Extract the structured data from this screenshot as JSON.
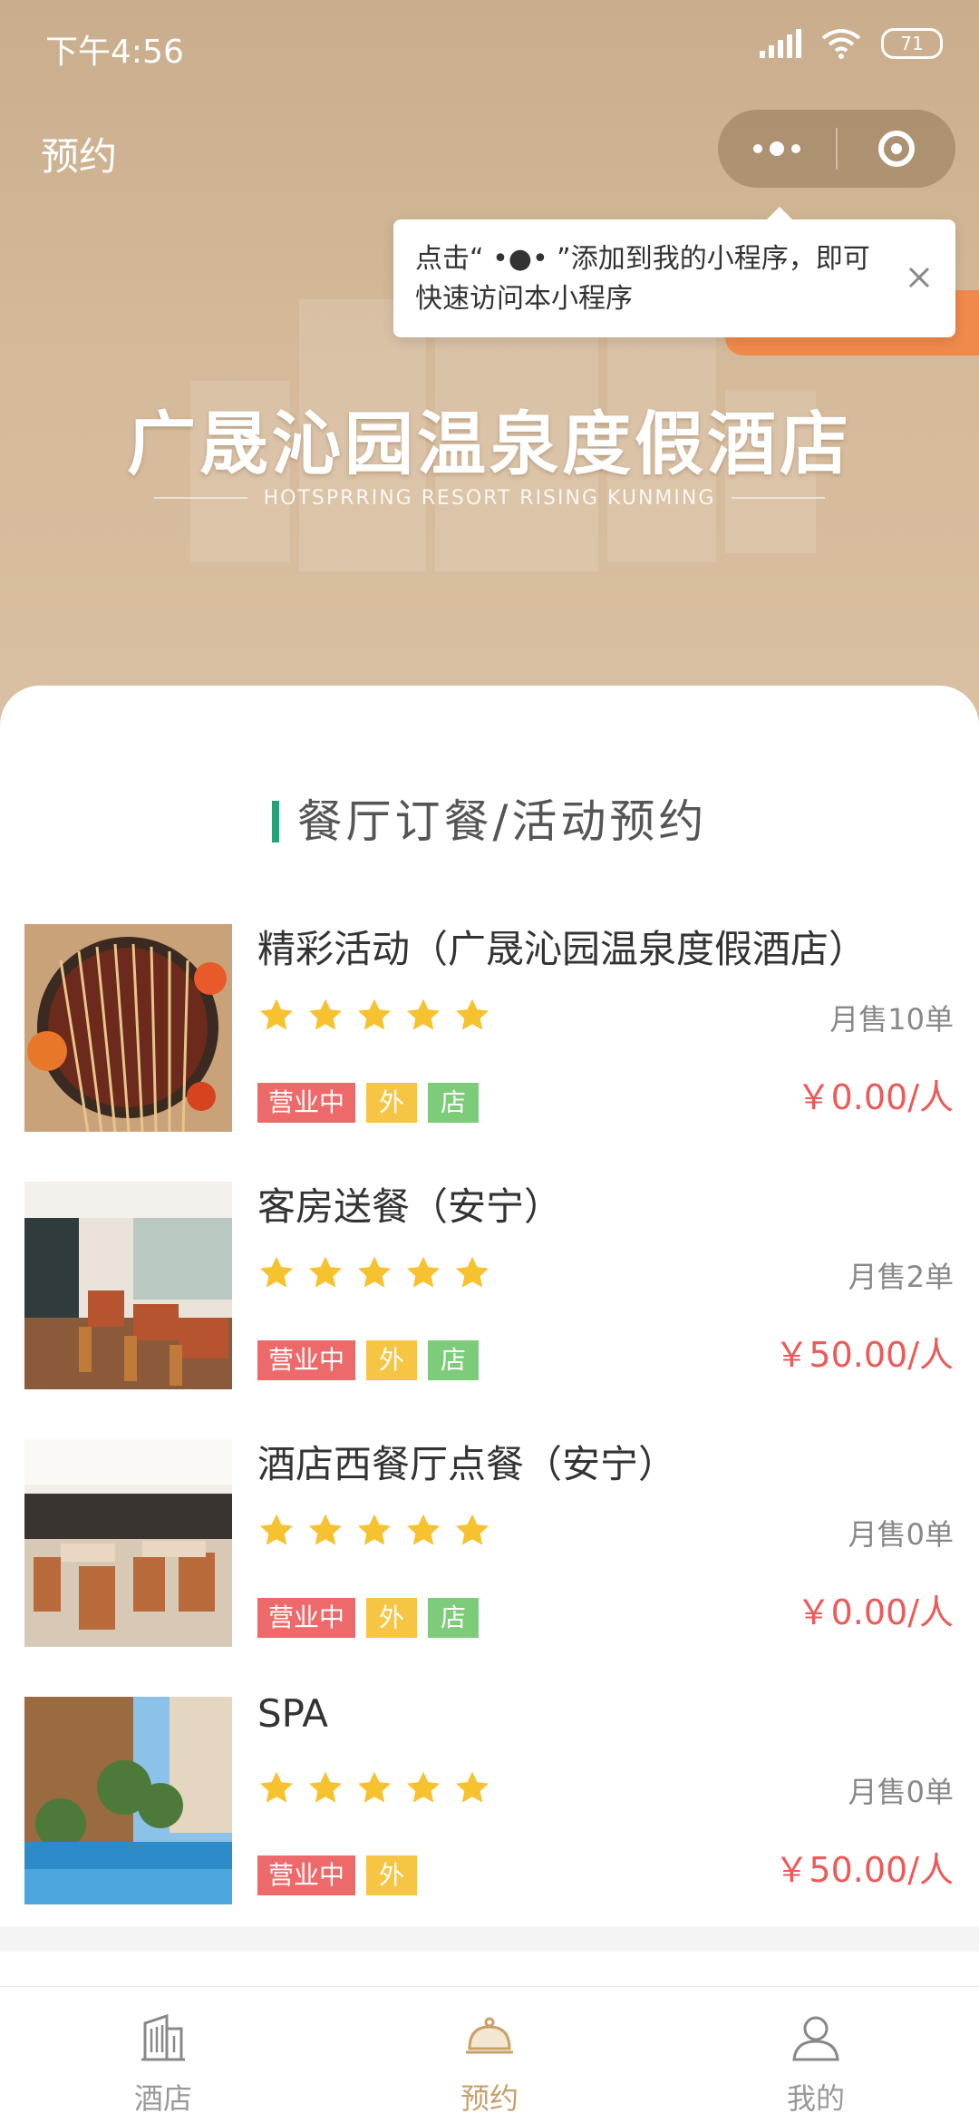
{
  "status_bar": {
    "time": "下午4:56",
    "battery": "71"
  },
  "nav": {
    "title": "预约"
  },
  "tooltip": {
    "text": "点击“ •●• ”添加到我的小程序，即可快速访问本小程序"
  },
  "hero": {
    "title": "广晟沁园温泉度假酒店",
    "subtitle": "HOTSPRRING RESORT RISING KUNMING"
  },
  "section": {
    "title": "餐厅订餐/活动预约"
  },
  "items": [
    {
      "name": "精彩活动（广晟沁园温泉度假酒店）",
      "rating": 5,
      "monthly": "月售10单",
      "price": "￥0.00/人",
      "status": "营业中",
      "tag_out": "外",
      "tag_shop": "店"
    },
    {
      "name": "客房送餐（安宁）",
      "rating": 5,
      "monthly": "月售2单",
      "price": "￥50.00/人",
      "status": "营业中",
      "tag_out": "外",
      "tag_shop": "店"
    },
    {
      "name": "酒店西餐厅点餐（安宁）",
      "rating": 5,
      "monthly": "月售0单",
      "price": "￥0.00/人",
      "status": "营业中",
      "tag_out": "外",
      "tag_shop": "店"
    },
    {
      "name": "SPA",
      "rating": 5,
      "monthly": "月售0单",
      "price": "￥50.00/人",
      "status": "营业中",
      "tag_out": "外"
    }
  ],
  "tabbar": {
    "hotel": "酒店",
    "booking": "预约",
    "mine": "我的",
    "active": "booking"
  },
  "colors": {
    "accent_green": "#22a37a",
    "price_red": "#ec5a5a",
    "star": "#f7c22f",
    "tab_active": "#c9a06a"
  }
}
